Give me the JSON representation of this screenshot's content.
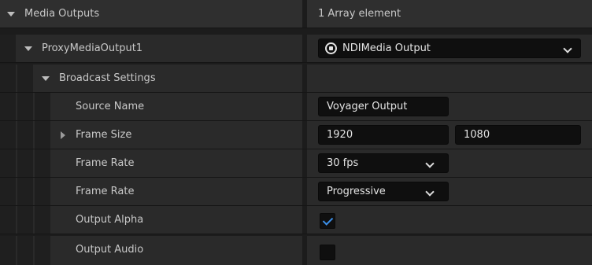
{
  "rows": {
    "media_outputs": {
      "label": "Media Outputs",
      "value": "1 Array element"
    },
    "proxy": {
      "label": "ProxyMediaOutput1",
      "value": "NDIMedia Output"
    },
    "broadcast": {
      "label": "Broadcast Settings"
    },
    "source_name": {
      "label": "Source Name",
      "value": "Voyager Output"
    },
    "frame_size": {
      "label": "Frame Size",
      "width": "1920",
      "height": "1080"
    },
    "frame_rate": {
      "label": "Frame Rate",
      "value": "30 fps"
    },
    "frame_rate_mode": {
      "label": "Frame Rate",
      "value": "Progressive"
    },
    "output_alpha": {
      "label": "Output Alpha",
      "checked": true
    },
    "output_audio": {
      "label": "Output Audio",
      "checked": false
    }
  },
  "icons": {
    "expand_down": "triangle-down",
    "expand_right": "triangle-right",
    "ndi": "ndi-media-icon",
    "dropdown": "chevron-down"
  },
  "colors": {
    "checkmark": "#3b8fe8",
    "panel": "#2a2a2a",
    "field": "#0f0f0f"
  }
}
